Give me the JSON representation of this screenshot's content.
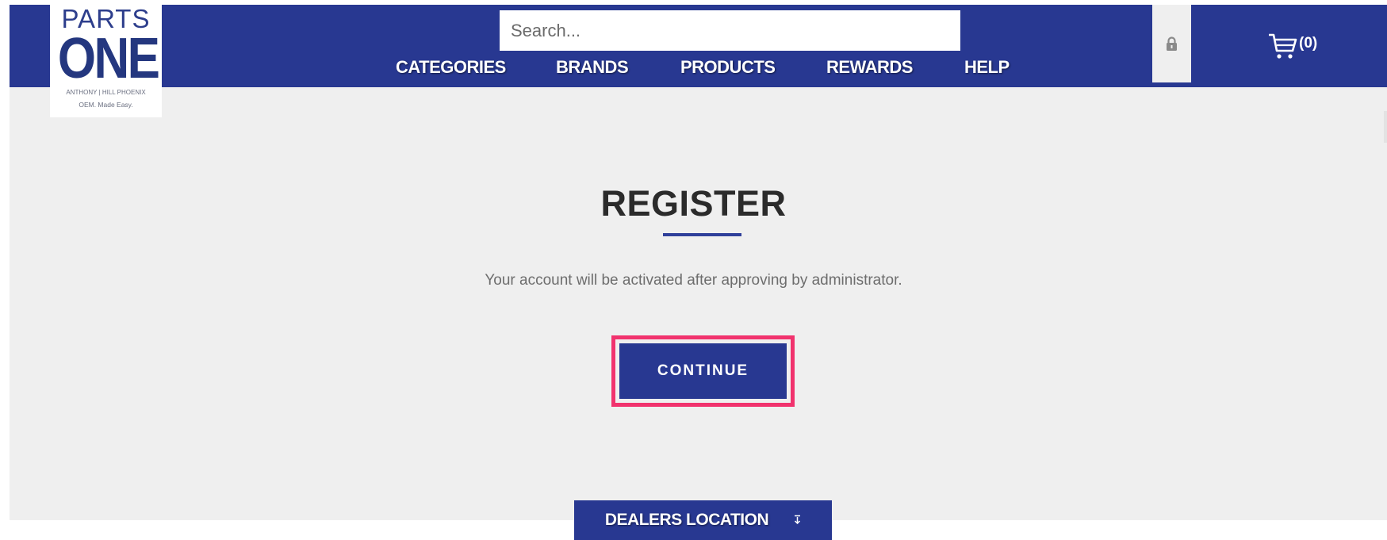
{
  "colors": {
    "brand_navy": "#283891",
    "content_bg": "#efefef",
    "highlight_pink": "#f1336e",
    "logo_blue": "#24377f"
  },
  "logo": {
    "top_text": "PARTS",
    "main_text": "ONE",
    "tagline_1": "ANTHONY | HILL PHOENIX",
    "tagline_2": "OEM. Made Easy."
  },
  "search": {
    "placeholder": "Search...",
    "value": ""
  },
  "nav": {
    "items": [
      {
        "label": "CATEGORIES"
      },
      {
        "label": "BRANDS"
      },
      {
        "label": "PRODUCTS"
      },
      {
        "label": "REWARDS"
      },
      {
        "label": "HELP"
      }
    ]
  },
  "header": {
    "lock_icon": "lock-icon",
    "cart_icon": "cart-icon",
    "cart_count": "(0)"
  },
  "main": {
    "title": "REGISTER",
    "message": "Your account will be activated after approving by administrator.",
    "continue_label": "CONTINUE"
  },
  "footer": {
    "dealers_label": "DEALERS LOCATION",
    "dealers_icon": "arrow-down-icon"
  }
}
